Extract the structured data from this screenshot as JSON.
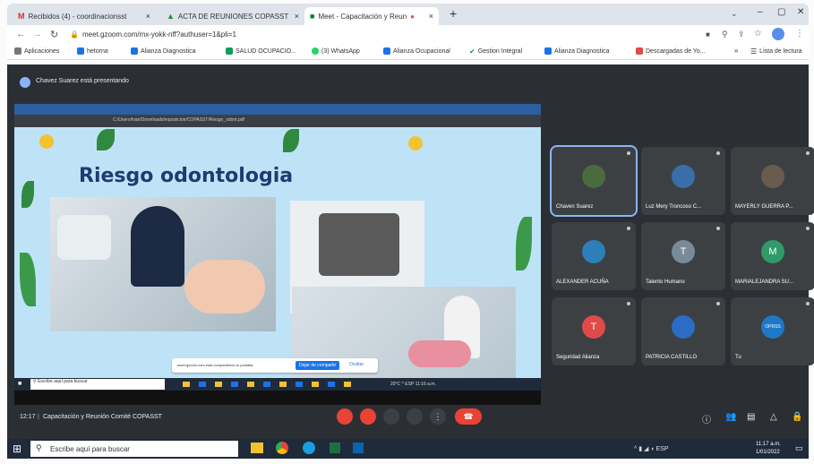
{
  "tabs": [
    {
      "label": "Recibidos (4) - coordinacionsst",
      "icon": "gmail-icon"
    },
    {
      "label": "ACTA DE REUNIONES COPASST",
      "icon": "drive-icon"
    },
    {
      "label": "Meet - Capacitación y Reun",
      "icon": "meet-icon"
    }
  ],
  "new_tab": "+",
  "address": "meet.gzoom.com/mx-yokk-nff?authuser=1&pli=1",
  "bookmarks": [
    "Aplicaciones",
    "hetorna",
    "Alianza Diagnostica",
    "SALUD OCUPACIO...",
    "(3) WhatsApp",
    "Alianza Ocupacional",
    "Gestion Integral",
    "Alianza Diagnostica",
    "Descargadas de Yo..."
  ],
  "reading_list": "Lista de lectura",
  "presenter_banner": "Chavez Suarez está presentando",
  "slide_title": "Riesgo odontologia",
  "inner_url": "C:/Users/Ivan/Downloads/exposicion/COPASST/Riesgo_odont.pdf",
  "share_notice": "meet.gzoom.com está compartiendo tu pantalla.",
  "share_stop": "Dejar de compartir",
  "share_hide": "Ocultar",
  "inner_search": "Escribe aquí para buscar",
  "inner_tray": "20°C  ^ ESP  11:16 a.m.",
  "participants": [
    {
      "name": "Chaven Suarez",
      "initial": "",
      "color": "#4a6b3d",
      "active": true
    },
    {
      "name": "Luz Mery Troncoso C...",
      "initial": "",
      "color": "#3a6ea8"
    },
    {
      "name": "MAYERLY GUERRA P...",
      "initial": "",
      "color": "#6a5b4f"
    },
    {
      "name": "ALEXANDER ACUÑA",
      "initial": "",
      "color": "#2c7fb8"
    },
    {
      "name": "Talento Humano",
      "initial": "T",
      "color": "#7b8a98"
    },
    {
      "name": "MARIALEJANDRA SU...",
      "initial": "M",
      "color": "#2f9a6a"
    },
    {
      "name": "Seguridad Alianza",
      "initial": "T",
      "color": "#e04a4a"
    },
    {
      "name": "PATRICIA CASTILLO",
      "initial": "",
      "color": "#2b6cc4"
    },
    {
      "name": "Tu",
      "initial": "OPRSS",
      "color": "#1e78c8"
    }
  ],
  "meeting_time": "12:17",
  "meeting_name": "Capacitación y Reunión Comité COPASST",
  "taskbar_search": "Escribe aquí para buscar",
  "tray_time": "11:17 a.m.",
  "tray_date": "1/01/2022",
  "colors": {
    "meet_bg": "#2b2f33",
    "hangup": "#ea4335",
    "slide_bg": "#bfe3f6"
  }
}
